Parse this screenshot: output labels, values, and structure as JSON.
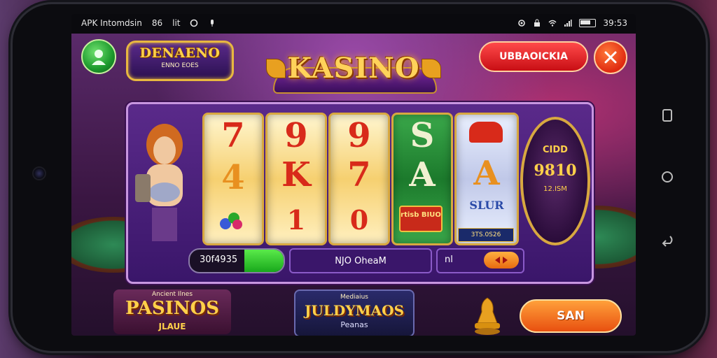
{
  "statusbar": {
    "app_title": "APK Intomdsin",
    "left_extra": "86",
    "left_extra2": "lit",
    "time": "39:53"
  },
  "game": {
    "logo_left_title": "DENAENO",
    "logo_left_subtitle": "ENNO EOES",
    "logo_main": "KASINO",
    "top_right_button": "UBBAOICKIA",
    "reels": [
      {
        "top": "7",
        "middle": "4",
        "bottom": ""
      },
      {
        "top": "9",
        "middle": "K",
        "bottom": "1"
      },
      {
        "top": "9",
        "middle": "7",
        "bottom": "0"
      },
      {
        "top": "S",
        "middle": "A",
        "bottom": "rtisb BIUO"
      },
      {
        "top": "",
        "middle": "A",
        "bottom": "SLUR"
      }
    ],
    "reel_footer_badge": "3TS.0S26",
    "jackpot_line1": "CIDD",
    "jackpot_line2": "9810",
    "jackpot_line3": "12.ISM",
    "balance_value": "30f4935",
    "balance_fill_fraction": 0.42,
    "message": "NJO OheaM",
    "bet_label": "nl",
    "bet_spin_icon": "arrows-icon"
  },
  "promos": [
    {
      "title": "PASINOS",
      "subtitle_top": "Ancient Ilnes",
      "subtitle_bottom": "JLAUE"
    },
    {
      "title": "JULDYMAOS",
      "subtitle_top": "Mediaius",
      "subtitle_bottom": "Peanas"
    }
  ],
  "spin_button": "SAN",
  "colors": {
    "accent_gold": "#ffd04a",
    "accent_red": "#e0141a",
    "accent_green": "#18a81c",
    "bg_purple": "#3a1642"
  }
}
